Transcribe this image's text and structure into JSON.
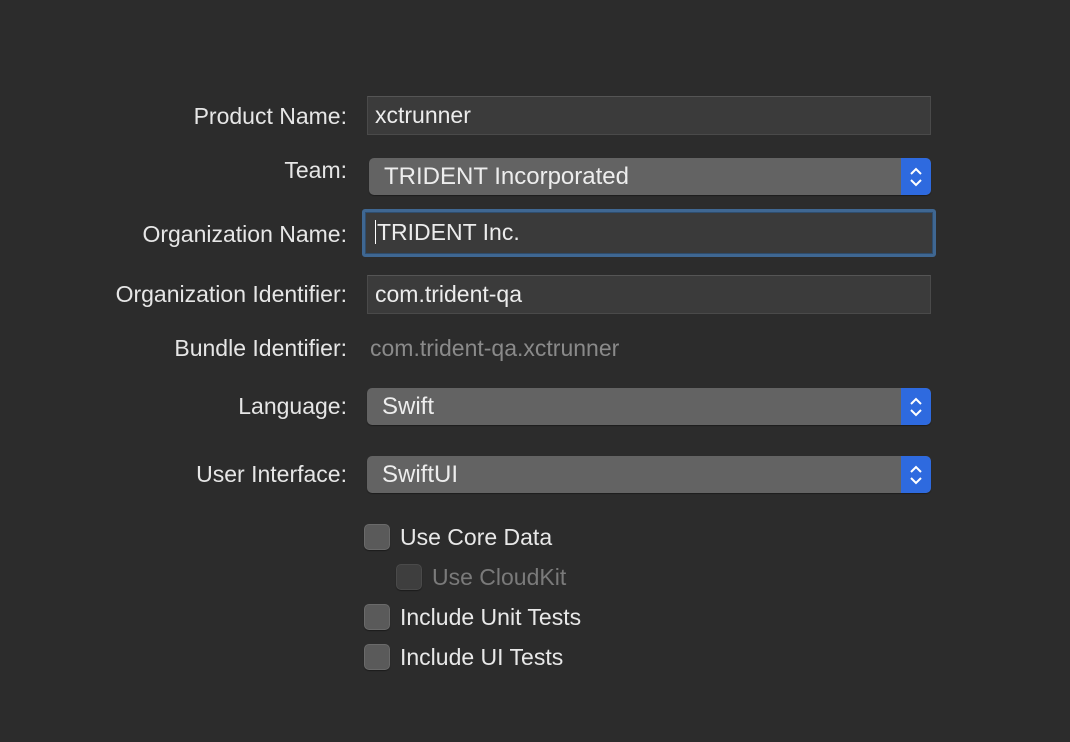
{
  "form": {
    "product_name": {
      "label": "Product Name:",
      "value": "xctrunner"
    },
    "team": {
      "label": "Team:",
      "value": "TRIDENT Incorporated"
    },
    "organization_name": {
      "label": "Organization Name:",
      "value": "TRIDENT Inc."
    },
    "organization_identifier": {
      "label": "Organization Identifier:",
      "value": "com.trident-qa"
    },
    "bundle_identifier": {
      "label": "Bundle Identifier:",
      "value": "com.trident-qa.xctrunner"
    },
    "language": {
      "label": "Language:",
      "value": "Swift"
    },
    "user_interface": {
      "label": "User Interface:",
      "value": "SwiftUI"
    }
  },
  "options": {
    "use_core_data": {
      "label": "Use Core Data",
      "checked": false,
      "enabled": true
    },
    "use_cloudkit": {
      "label": "Use CloudKit",
      "checked": false,
      "enabled": false
    },
    "include_unit_tests": {
      "label": "Include Unit Tests",
      "checked": false,
      "enabled": true
    },
    "include_ui_tests": {
      "label": "Include UI Tests",
      "checked": false,
      "enabled": true
    }
  },
  "colors": {
    "background": "#2c2c2c",
    "accent": "#2e6adf",
    "focus_ring": "#3f6792"
  },
  "icons": {
    "popup_stepper": "chevron-up-down-icon"
  }
}
